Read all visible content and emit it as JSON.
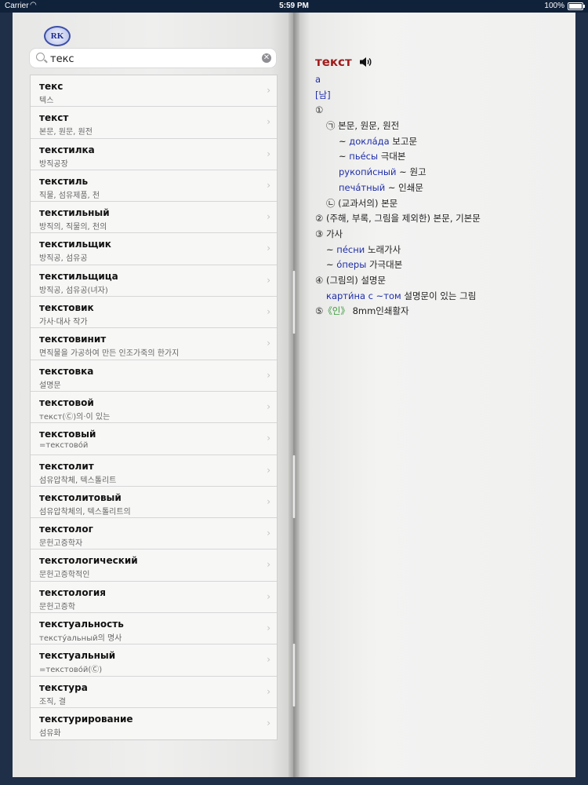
{
  "status_bar": {
    "carrier": "Carrier",
    "time": "5:59 PM",
    "battery": "100%"
  },
  "logo": "RK",
  "search": {
    "value": "текс",
    "placeholder": ""
  },
  "words": [
    {
      "word": "текс",
      "meaning": "텍스"
    },
    {
      "word": "текст",
      "meaning": "본문, 원문, 원전"
    },
    {
      "word": "текстилка",
      "meaning": "방직공장"
    },
    {
      "word": "текстиль",
      "meaning": "직물, 섬유제품, 천"
    },
    {
      "word": "текстильный",
      "meaning": "방직의, 직물의, 천의"
    },
    {
      "word": "текстильщик",
      "meaning": "방직공, 섬유공"
    },
    {
      "word": "текстильщица",
      "meaning": "방직공, 섬유공(녀자)"
    },
    {
      "word": "текстовик",
      "meaning": "가사·대사 작가"
    },
    {
      "word": "текстовинит",
      "meaning": "면직물을 가공하여 만든 인조가죽의 한가지"
    },
    {
      "word": "текстовка",
      "meaning": "설명문"
    },
    {
      "word": "текстовой",
      "meaning": "текст(Ⓒ)의·이 있는"
    },
    {
      "word": "текстовый",
      "meaning": "=текстово́й"
    },
    {
      "word": "текстолит",
      "meaning": "섬유압착체, 텍스톨리트"
    },
    {
      "word": "текстолитовый",
      "meaning": "섬유압착체의, 텍스톨리트의"
    },
    {
      "word": "текстолог",
      "meaning": "문헌고증학자"
    },
    {
      "word": "текстологический",
      "meaning": "문헌고증학적인"
    },
    {
      "word": "текстология",
      "meaning": "문헌고증학"
    },
    {
      "word": "текстуальность",
      "meaning": "тексту́альный의 명사"
    },
    {
      "word": "текстуальный",
      "meaning": "=текстово́й(Ⓒ)"
    },
    {
      "word": "текстура",
      "meaning": "조직, 결"
    },
    {
      "word": "текстурирование",
      "meaning": "섬유화"
    }
  ],
  "entry": {
    "headword": "текст",
    "speaker_icon": "speaker-icon",
    "stress": "а",
    "gender": "[남]",
    "s1_marker": "①",
    "s1a": "㉠ 본문, 원문, 원전",
    "ex1_ru": "доклáда",
    "ex1_ko": "보고문",
    "ex2_ru": "пьéсы",
    "ex2_ko": "극대본",
    "ex3_ru": "рукопи́сный",
    "ex3_ko": "원고",
    "ex4_ru": "печáтный",
    "ex4_ko": "인쇄문",
    "s1b": "㉡ (교과서의) 본문",
    "s2": "② (주해, 부록, 그림을 제외한) 본문, 기본문",
    "s3": "③ 가사",
    "ex5_ru": "пéсни",
    "ex5_ko": "노래가사",
    "ex6_ru": "óперы",
    "ex6_ko": "가극대본",
    "s4": "④ (그림의) 설명문",
    "ex7_ru": "карти́на с ~том",
    "ex7_ko": "설명문이 있는 그림",
    "s5_marker": "⑤",
    "s5_label": "《인》",
    "s5_text": "8mm인쇄활자",
    "tilde": "~"
  },
  "colors": {
    "headword": "#a01c1c",
    "russian": "#1f2ea8",
    "label": "#3a9a3a"
  }
}
